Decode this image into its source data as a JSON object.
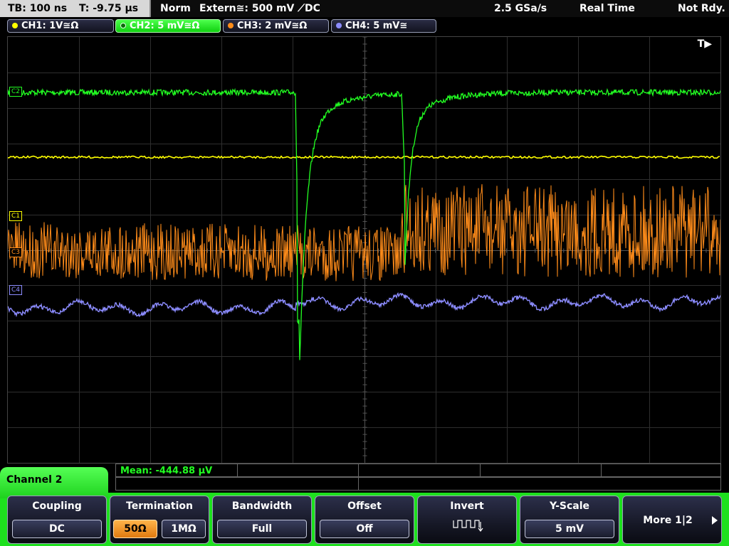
{
  "topbar": {
    "timebase": "TB: 100 ns",
    "trigger_time": "T: -9.75 µs",
    "mode": "Norm",
    "trigger_source": "Extern≅: 500 mV ⟋DC",
    "sample_rate": "2.5 GSa/s",
    "acq_mode": "Real Time",
    "status": "Not Rdy."
  },
  "channels": [
    {
      "label": "CH1: 1V≅Ω",
      "color": "#ffff00",
      "active": false
    },
    {
      "label": "CH2: 5 mV≅Ω",
      "color": "#22ff22",
      "active": true
    },
    {
      "label": "CH3: 2 mV≅Ω",
      "color": "#ff8c1a",
      "active": false
    },
    {
      "label": "CH4: 5 mV≅",
      "color": "#8c8cff",
      "active": false
    }
  ],
  "plot": {
    "trigger_marker": "T▶",
    "markers": {
      "c1": "C1",
      "c2": "C2",
      "c3": "C3",
      "c4": "C4"
    }
  },
  "measurement": {
    "mean": "Mean: -444.88 µV"
  },
  "channel_menu_title": "Channel 2",
  "softkeys": {
    "coupling": {
      "title": "Coupling",
      "value": "DC"
    },
    "termination": {
      "title": "Termination",
      "opt1": "50Ω",
      "opt2": "1MΩ"
    },
    "bandwidth": {
      "title": "Bandwidth",
      "value": "Full"
    },
    "offset": {
      "title": "Offset",
      "value": "Off"
    },
    "invert": {
      "title": "Invert",
      "icon": "invert-waveform-icon"
    },
    "yscale": {
      "title": "Y-Scale",
      "value": "5 mV"
    },
    "more": {
      "label": "More 1|2",
      "icon": "play-arrow-icon"
    }
  }
}
